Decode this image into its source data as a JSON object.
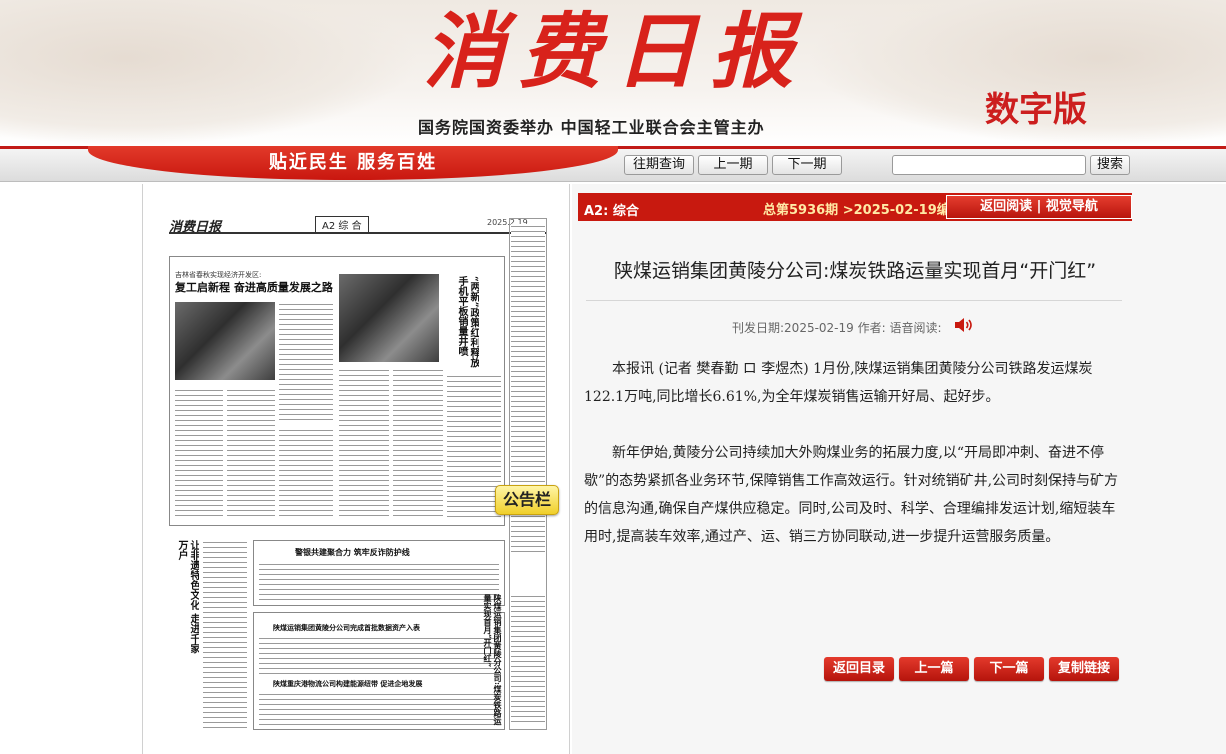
{
  "masthead": {
    "title": "消费日报",
    "edition": "数字版",
    "sponsor": "国务院国资委举办  中国轻工业联合会主管主办"
  },
  "nav": {
    "slogan": "贴近民生  服务百姓",
    "archive_label": "往期查询",
    "prev_label": "上一期",
    "next_label": "下一期",
    "search_placeholder": "",
    "search_label": "搜索"
  },
  "newspaper": {
    "logo": "消费日报",
    "section": "综 合",
    "section_code": "A2",
    "date": "2025.2.19",
    "headline_1_kicker": "吉林省春秋实现经济开发区:",
    "headline_1": "复工启新程  奋进高质量发展之路",
    "headline_2": "“两新”政策红利释放 手机平板销量井喷",
    "headline_3": "警银共建聚合力 筑牢反诈防护线",
    "headline_4": "让非遗特色文化 走进千家万户",
    "headline_5": "陕煤运销集团黄陵分公司完成首批数据资产入表",
    "headline_6": "陕煤重庆港物流公司构建能源纽带 促进企地发展",
    "headline_7": "陕煤运销集团黄陵分公司:煤炭铁路运量实现首月“开门红”",
    "notice_label": "公告栏"
  },
  "article": {
    "section": "A2:  综合",
    "issue": "总第5936期 >2025-02-19编印",
    "back_label": "返回阅读 | 视觉导航",
    "title": "陕煤运销集团黄陵分公司:煤炭铁路运量实现首月“开门红”",
    "meta": "刊发日期:2025-02-19  作者:     语音阅读:",
    "paragraphs": [
      "本报讯 (记者 樊春勤 ロ 李煜杰) 1月份,陕煤运销集团黄陵分公司铁路发运煤炭122.1万吨,同比增长6.61%,为全年煤炭销售运输开好局、起好步。",
      "新年伊始,黄陵分公司持续加大外购煤业务的拓展力度,以“开局即冲刺、奋进不停歇”的态势紧抓各业务环节,保障销售工作高效运行。针对统销矿井,公司时刻保持与矿方的信息沟通,确保自产煤供应稳定。同时,公司及时、科学、合理编排发运计划,缩短装车用时,提高装车效率,通过产、运、销三方协同联动,进一步提升运营服务质量。"
    ],
    "buttons": {
      "toc": "返回目录",
      "prev": "上一篇",
      "next": "下一篇",
      "copy": "复制链接"
    }
  },
  "colors": {
    "brand_red": "#c8190f",
    "masthead_red": "#d8221b",
    "issue_gold": "#ffe9a5"
  },
  "icons": {
    "speaker": "speaker-icon"
  }
}
